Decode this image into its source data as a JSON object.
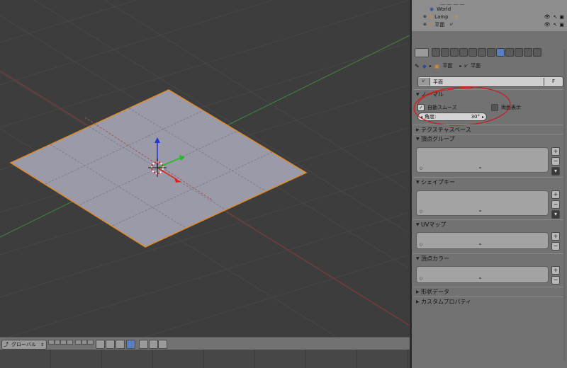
{
  "colors": {
    "viewport_bg": "#3d3d3d",
    "panel_bg": "#727272",
    "annotation": "#d11a1a",
    "plane_fill": "#9a9aa9",
    "plane_edge": "#e08a2a"
  },
  "outliner": {
    "rows": [
      {
        "label": "World"
      },
      {
        "label": "Lamp"
      },
      {
        "label": "平面"
      }
    ]
  },
  "breadcrumb": {
    "object": "平面",
    "mesh": "平面"
  },
  "name_field": {
    "value": "平面",
    "fake_user": "F"
  },
  "normals": {
    "title": "ノーマル",
    "auto_smooth_label": "自動スムーズ",
    "double_sided_label": "両面表示",
    "angle_label": "角度:",
    "angle_value": "30°"
  },
  "sections": {
    "texture_space": "テクスチャスペース",
    "vertex_groups": "頂点グループ",
    "shape_keys": "シェイプキー",
    "uv_maps": "UVマップ",
    "vertex_colors": "頂点カラー",
    "geometry_data": "形状データ",
    "custom_props": "カスタムプロパティ"
  },
  "viewport_header": {
    "orientation": "グローバル"
  }
}
